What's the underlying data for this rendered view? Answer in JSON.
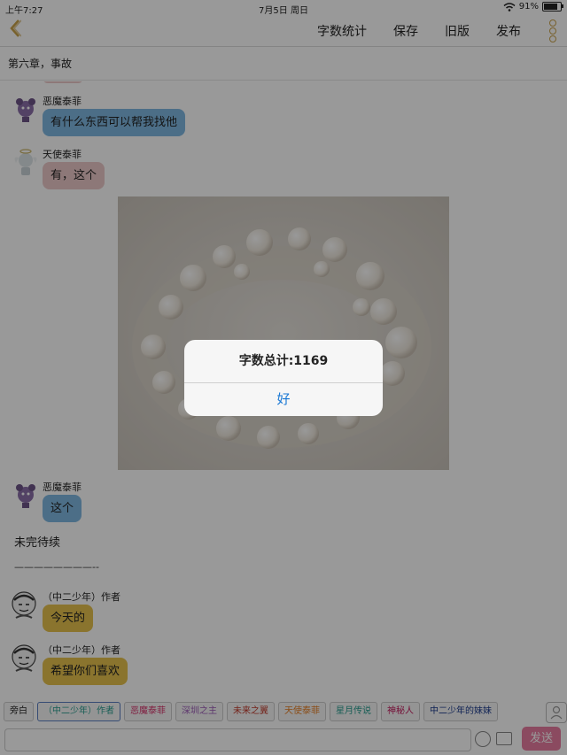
{
  "status_bar": {
    "time": "上午7:27",
    "date": "7月5日 周日",
    "battery": "91%",
    "battery_level": 0.91
  },
  "nav": {
    "back_icon": "chevron-left-icon",
    "actions": [
      "字数统计",
      "保存",
      "旧版",
      "发布"
    ],
    "more_icon": "more-vertical-icon"
  },
  "chapter_title": "第六章，事故",
  "messages": [
    {
      "name": "恶魔泰菲",
      "text": "有什么东西可以帮我找他",
      "style": "blue",
      "avatar": "devil-tiffy-avatar"
    },
    {
      "name": "天使泰菲",
      "text": "有，这个",
      "style": "pink",
      "avatar": "angel-tiffy-avatar"
    },
    {
      "name": "恶魔泰菲",
      "text": "这个",
      "style": "blue",
      "avatar": "devil-tiffy-avatar"
    }
  ],
  "narration": [
    "未完待续",
    "————————--"
  ],
  "author_messages": [
    {
      "name": "（中二少年）作者",
      "text": "今天的",
      "avatar": "author-avatar"
    },
    {
      "name": "（中二少年）作者",
      "text": "希望你们喜欢",
      "avatar": "author-avatar"
    }
  ],
  "dialog": {
    "message": "字数总计:1169",
    "ok": "好"
  },
  "tags": [
    {
      "label": "旁白",
      "color": "#222222"
    },
    {
      "label": "（中二少年）作者",
      "color": "#2a9d8f"
    },
    {
      "label": "恶魔泰菲",
      "color": "#d6336c"
    },
    {
      "label": "深圳之主",
      "color": "#9b59b6"
    },
    {
      "label": "未来之翼",
      "color": "#c0392b"
    },
    {
      "label": "天使泰菲",
      "color": "#e67e22"
    },
    {
      "label": "星月传说",
      "color": "#2a9d8f"
    },
    {
      "label": "神秘人",
      "color": "#c2185b"
    },
    {
      "label": "中二少年的妹妹",
      "color": "#1a3a8c"
    }
  ],
  "input": {
    "send": "发送",
    "emoji_icon": "emoji-icon",
    "image_icon": "image-icon",
    "user_icon": "user-icon"
  },
  "colors": {
    "accent": "#c9a24a",
    "send_button": "#e87ca0",
    "dialog_button": "#1877d4",
    "bubble_blue": "#7fb8e2",
    "bubble_pink": "#ecc9c9",
    "bubble_gold": "#e6c24e"
  }
}
